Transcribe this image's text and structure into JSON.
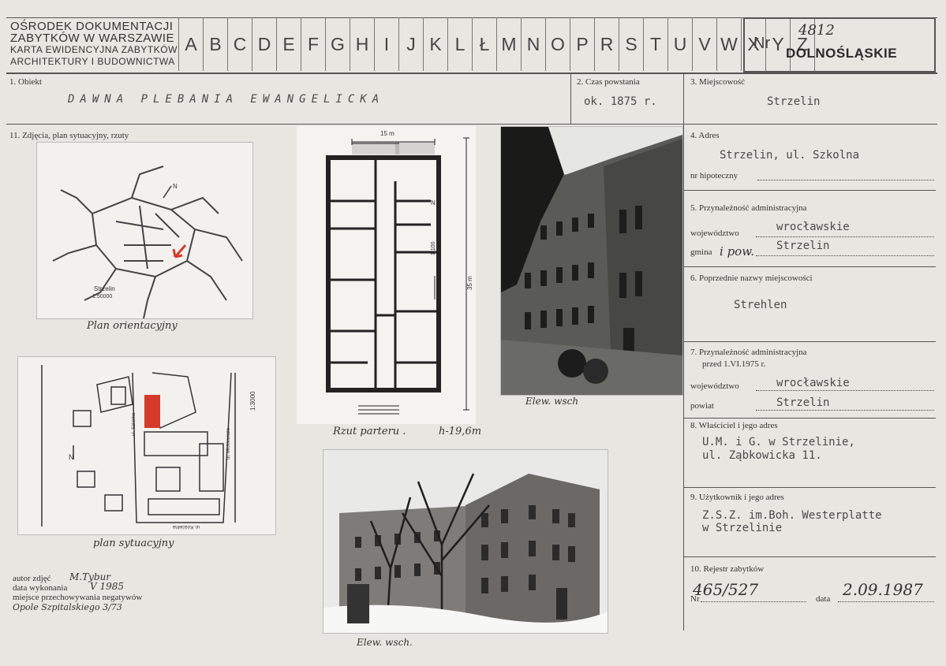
{
  "header": {
    "institution_lines": [
      "OŚRODEK DOKUMENTACJI",
      "ZABYTKÓW W WARSZAWIE",
      "KARTA EWIDENCYJNA ZABYTKÓW",
      "ARCHITEKTURY I BUDOWNICTWA"
    ],
    "letters": [
      "A",
      "B",
      "C",
      "D",
      "E",
      "F",
      "G",
      "H",
      "I",
      "J",
      "K",
      "L",
      "Ł",
      "M",
      "N",
      "O",
      "P",
      "R",
      "S",
      "T",
      "U",
      "V",
      "W",
      "X",
      "Y",
      "Z"
    ],
    "nr_label": "Nr",
    "nr_value": "4812",
    "voivodeship": "DOLNOŚLĄSKIE"
  },
  "fields": {
    "obiekt": {
      "label": "1. Obiekt",
      "value": "DAWNA PLEBANIA EWANGELICKA"
    },
    "czas": {
      "label": "2. Czas powstania",
      "value": "ok. 1875 r."
    },
    "miejscowosc": {
      "label": "3. Miejscowość",
      "value": "Strzelin"
    },
    "adres": {
      "label": "4. Adres",
      "value": "Strzelin, ul. Szkolna",
      "hipoteczny_label": "nr hipoteczny"
    },
    "przynaleznosc": {
      "label": "5. Przynależność administracyjna",
      "woj_label": "województwo",
      "woj_value": "wrocławskie",
      "gmina_label": "gmina",
      "gmina_hand": "i pow.",
      "gmina_value": "Strzelin"
    },
    "poprzednie": {
      "label": "6. Poprzednie nazwy miejscowości",
      "value": "Strehlen"
    },
    "przynaleznosc_przed": {
      "label": "7. Przynależność administracyjna",
      "label2": "przed 1.VI.1975 r.",
      "woj_label": "województwo",
      "woj_value": "wrocławskie",
      "powiat_label": "powiat",
      "powiat_value": "Strzelin"
    },
    "wlasciciel": {
      "label": "8. Właściciel i jego adres",
      "line1": "U.M. i G. w Strzelinie,",
      "line2": "ul. Ząbkowicka 11."
    },
    "uzytkownik": {
      "label": "9. Użytkownik i jego adres",
      "line1": "Z.S.Z. im.Boh. Westerplatte",
      "line2": "w Strzelinie"
    },
    "rejestr": {
      "label": "10. Rejestr zabytków",
      "nr_label": "Nr",
      "nr_value": "465/527",
      "data_label": "data",
      "data_value": "2.09.1987"
    }
  },
  "photos_section": {
    "label": "11. Zdjęcia, plan sytuacyjny, rzuty",
    "captions": {
      "plan_orient": "Plan orientacyjny",
      "plan_syt": "plan sytuacyjny",
      "rzut": "Rzut parteru .",
      "rzut_h": "h-19,6m",
      "elew_top": "Elew. wsch",
      "elew_bottom": "Elew. wsch."
    },
    "map_texts": {
      "city": "Strzelin",
      "scale1": "1:50000",
      "scale2": "1:3000",
      "street1": "ul. Szkolna",
      "street2": "ul. Mickiewicza",
      "street3": "ul. Kościelna",
      "north": "N"
    },
    "floorplan_texts": {
      "width": "15 m",
      "length": "35 m",
      "scale": "1:100",
      "north": "N"
    }
  },
  "footer": {
    "autor_label": "autor zdjęć",
    "autor_value": "M.Tybur",
    "data_label": "data wykonania",
    "data_value": "V 1985",
    "miejsce_label": "miejsce przechowywania negatywów",
    "miejsce_value": "Opole Szpitalskiego 3/73"
  },
  "colors": {
    "paper": "#e8e6e0",
    "ink": "#2b2b2b",
    "accent_red": "#d63a2a"
  }
}
